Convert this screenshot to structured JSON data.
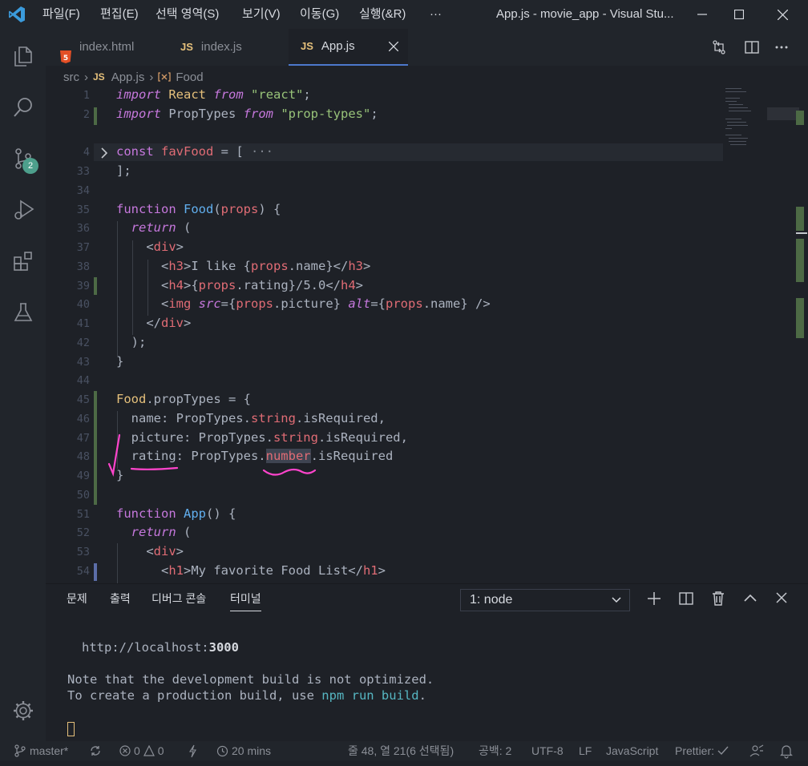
{
  "menu": [
    "파일(F)",
    "편집(E)",
    "선택 영역(S)",
    "보기(V)",
    "이동(G)",
    "실행(&R)",
    "···"
  ],
  "window_title": "App.js - movie_app - Visual Stu...",
  "tabs": [
    {
      "label": "index.html",
      "type": "html"
    },
    {
      "label": "index.js",
      "type": "JS"
    },
    {
      "label": "App.js",
      "type": "JS",
      "active": true
    }
  ],
  "breadcrumb": {
    "folder": "src",
    "file": "App.js",
    "symbol": "Food",
    "js": "JS"
  },
  "scm_badge": "2",
  "editor": {
    "lines": [
      {
        "n": "1",
        "parts": [
          [
            "kwi",
            "import"
          ],
          [
            "",
            " "
          ],
          [
            "cls",
            "React"
          ],
          [
            "",
            " "
          ],
          [
            "kwi",
            "from"
          ],
          [
            "",
            " "
          ],
          [
            "str",
            "\"react\""
          ],
          [
            "",
            ";"
          ]
        ]
      },
      {
        "n": "2",
        "parts": [
          [
            "kwi",
            "import"
          ],
          [
            "",
            " PropTypes "
          ],
          [
            "kwi",
            "from"
          ],
          [
            "",
            " "
          ],
          [
            "str",
            "\"prop-types\""
          ],
          [
            "",
            ";"
          ]
        ]
      },
      {
        "n": "",
        "parts": []
      },
      {
        "n": "4",
        "parts": [
          [
            "kw",
            "const"
          ],
          [
            "",
            " "
          ],
          [
            "var",
            "favFood"
          ],
          [
            "",
            " = [ "
          ],
          [
            "dim",
            "···"
          ]
        ]
      },
      {
        "n": "33",
        "parts": [
          [
            "",
            "];"
          ]
        ]
      },
      {
        "n": "34",
        "parts": []
      },
      {
        "n": "35",
        "parts": [
          [
            "kw",
            "function"
          ],
          [
            "",
            " "
          ],
          [
            "fn",
            "Food"
          ],
          [
            "",
            "("
          ],
          [
            "var",
            "props"
          ],
          [
            "",
            ") {"
          ]
        ]
      },
      {
        "n": "36",
        "parts": [
          [
            "",
            "  "
          ],
          [
            "kwi",
            "return"
          ],
          [
            "",
            " ("
          ]
        ]
      },
      {
        "n": "37",
        "parts": [
          [
            "",
            "    <"
          ],
          [
            "tag",
            "div"
          ],
          [
            "",
            ">"
          ]
        ]
      },
      {
        "n": "38",
        "parts": [
          [
            "",
            "      <"
          ],
          [
            "tag",
            "h3"
          ],
          [
            "",
            ">I like {"
          ],
          [
            "var",
            "props"
          ],
          [
            "",
            ".name}</"
          ],
          [
            "tag",
            "h3"
          ],
          [
            "",
            ">"
          ]
        ]
      },
      {
        "n": "39",
        "parts": [
          [
            "",
            "      <"
          ],
          [
            "tag",
            "h4"
          ],
          [
            "",
            ">{"
          ],
          [
            "var",
            "props"
          ],
          [
            "",
            ".rating}/5.0</"
          ],
          [
            "tag",
            "h4"
          ],
          [
            "",
            ">"
          ]
        ]
      },
      {
        "n": "40",
        "parts": [
          [
            "",
            "      <"
          ],
          [
            "tag",
            "img"
          ],
          [
            "",
            " "
          ],
          [
            "attri",
            "src"
          ],
          [
            "",
            "={"
          ],
          [
            "var",
            "props"
          ],
          [
            "",
            ".picture} "
          ],
          [
            "attri",
            "alt"
          ],
          [
            "",
            "={"
          ],
          [
            "var",
            "props"
          ],
          [
            "",
            ".name} />"
          ]
        ]
      },
      {
        "n": "41",
        "parts": [
          [
            "",
            "    </"
          ],
          [
            "tag",
            "div"
          ],
          [
            "",
            ">"
          ]
        ]
      },
      {
        "n": "42",
        "parts": [
          [
            "",
            "  );"
          ]
        ]
      },
      {
        "n": "43",
        "parts": [
          [
            "",
            "}"
          ]
        ]
      },
      {
        "n": "44",
        "parts": []
      },
      {
        "n": "45",
        "parts": [
          [
            "cls",
            "Food"
          ],
          [
            "",
            ".propTypes = {"
          ]
        ]
      },
      {
        "n": "46",
        "parts": [
          [
            "",
            "  name: PropTypes."
          ],
          [
            "prop",
            "string"
          ],
          [
            "",
            ".isRequired,"
          ]
        ]
      },
      {
        "n": "47",
        "parts": [
          [
            "",
            "  picture: PropTypes."
          ],
          [
            "prop",
            "string"
          ],
          [
            "",
            ".isRequired,"
          ]
        ]
      },
      {
        "n": "48",
        "parts": [
          [
            "",
            "  rating: PropTypes."
          ],
          [
            "prop",
            "number"
          ],
          [
            "",
            ".isRequired"
          ]
        ]
      },
      {
        "n": "49",
        "parts": [
          [
            "",
            "}"
          ]
        ]
      },
      {
        "n": "50",
        "parts": []
      },
      {
        "n": "51",
        "parts": [
          [
            "kw",
            "function"
          ],
          [
            "",
            " "
          ],
          [
            "fn",
            "App"
          ],
          [
            "",
            "() {"
          ]
        ]
      },
      {
        "n": "52",
        "parts": [
          [
            "",
            "  "
          ],
          [
            "kwi",
            "return"
          ],
          [
            "",
            " ("
          ]
        ]
      },
      {
        "n": "53",
        "parts": [
          [
            "",
            "    <"
          ],
          [
            "tag",
            "div"
          ],
          [
            "",
            ">"
          ]
        ]
      },
      {
        "n": "54",
        "parts": [
          [
            "",
            "      <"
          ],
          [
            "tag",
            "h1"
          ],
          [
            "",
            ">My favorite Food List</"
          ],
          [
            "tag",
            "h1"
          ],
          [
            "",
            ">"
          ]
        ]
      }
    ]
  },
  "panel": {
    "tabs": [
      "문제",
      "출력",
      "디버그 콘솔",
      "터미널"
    ],
    "active_tab": "터미널",
    "terminal_select": "1: node",
    "terminal": {
      "url_prefix": "http://localhost:",
      "url_port": "3000",
      "note1": "Note that the development build is not optimized.",
      "note2_a": "To create a production build, use ",
      "note2_cmd": "npm run build",
      "note2_b": "."
    }
  },
  "status": {
    "branch": "master*",
    "errors": "0",
    "warnings": "0",
    "time": "20 mins",
    "position": "줄 48, 열 21(6 선택됨)",
    "spaces": "공백: 2",
    "encoding": "UTF-8",
    "eol": "LF",
    "language": "JavaScript",
    "formatter": "Prettier:"
  },
  "colors": {
    "accent": "#4d78cc",
    "annotation": "#ff44cc",
    "git_added": "#4d6a45"
  }
}
